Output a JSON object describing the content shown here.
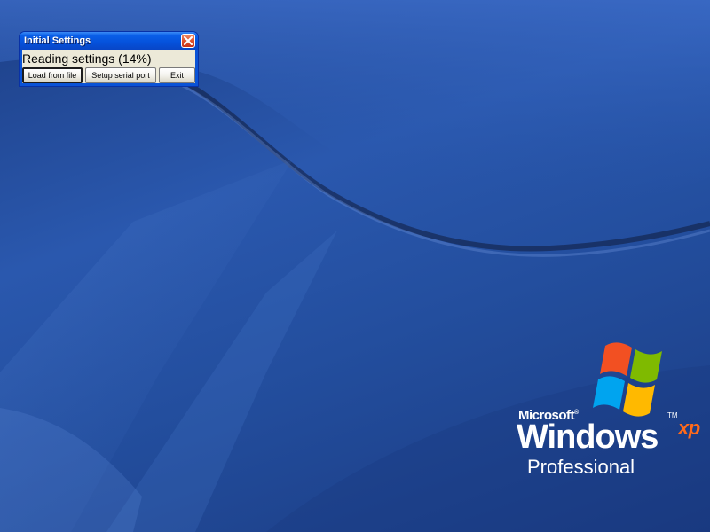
{
  "desktop": {
    "wallpaper": "Windows XP Professional default blue wallpaper",
    "colors": {
      "background_dark": "#1d3f86",
      "background_mid": "#2a58ae"
    }
  },
  "logo": {
    "microsoft": "Microsoft",
    "windows": "Windows",
    "xp": "xp",
    "tm": "TM",
    "edition": "Professional",
    "flag_colors": {
      "red": "#f25022",
      "green": "#7fba00",
      "blue": "#00a4ef",
      "yellow": "#ffb900"
    }
  },
  "dialog": {
    "title": "Initial Settings",
    "close_icon": "close-icon",
    "status": "Reading settings (14%)",
    "progress_percent": 14,
    "buttons": {
      "load": "Load from file",
      "serial": "Setup serial port",
      "exit": "Exit"
    },
    "colors": {
      "titlebar": "#0551db",
      "client": "#ece9d8",
      "close": "#e0512c"
    }
  }
}
